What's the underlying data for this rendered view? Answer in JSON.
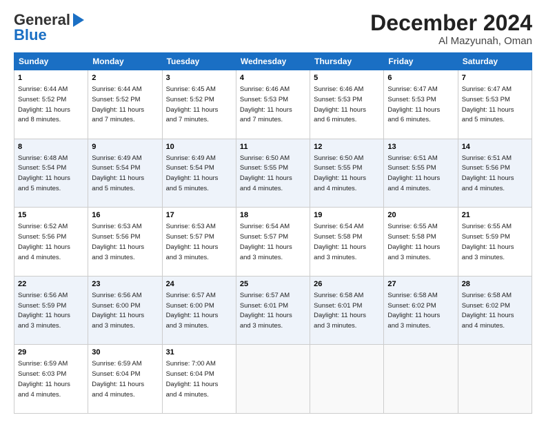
{
  "header": {
    "logo_line1": "General",
    "logo_line2": "Blue",
    "month_title": "December 2024",
    "location": "Al Mazyunah, Oman"
  },
  "days_of_week": [
    "Sunday",
    "Monday",
    "Tuesday",
    "Wednesday",
    "Thursday",
    "Friday",
    "Saturday"
  ],
  "weeks": [
    [
      {
        "day": "1",
        "info": "Sunrise: 6:44 AM\nSunset: 5:52 PM\nDaylight: 11 hours\nand 8 minutes."
      },
      {
        "day": "2",
        "info": "Sunrise: 6:44 AM\nSunset: 5:52 PM\nDaylight: 11 hours\nand 7 minutes."
      },
      {
        "day": "3",
        "info": "Sunrise: 6:45 AM\nSunset: 5:52 PM\nDaylight: 11 hours\nand 7 minutes."
      },
      {
        "day": "4",
        "info": "Sunrise: 6:46 AM\nSunset: 5:53 PM\nDaylight: 11 hours\nand 7 minutes."
      },
      {
        "day": "5",
        "info": "Sunrise: 6:46 AM\nSunset: 5:53 PM\nDaylight: 11 hours\nand 6 minutes."
      },
      {
        "day": "6",
        "info": "Sunrise: 6:47 AM\nSunset: 5:53 PM\nDaylight: 11 hours\nand 6 minutes."
      },
      {
        "day": "7",
        "info": "Sunrise: 6:47 AM\nSunset: 5:53 PM\nDaylight: 11 hours\nand 5 minutes."
      }
    ],
    [
      {
        "day": "8",
        "info": "Sunrise: 6:48 AM\nSunset: 5:54 PM\nDaylight: 11 hours\nand 5 minutes."
      },
      {
        "day": "9",
        "info": "Sunrise: 6:49 AM\nSunset: 5:54 PM\nDaylight: 11 hours\nand 5 minutes."
      },
      {
        "day": "10",
        "info": "Sunrise: 6:49 AM\nSunset: 5:54 PM\nDaylight: 11 hours\nand 5 minutes."
      },
      {
        "day": "11",
        "info": "Sunrise: 6:50 AM\nSunset: 5:55 PM\nDaylight: 11 hours\nand 4 minutes."
      },
      {
        "day": "12",
        "info": "Sunrise: 6:50 AM\nSunset: 5:55 PM\nDaylight: 11 hours\nand 4 minutes."
      },
      {
        "day": "13",
        "info": "Sunrise: 6:51 AM\nSunset: 5:55 PM\nDaylight: 11 hours\nand 4 minutes."
      },
      {
        "day": "14",
        "info": "Sunrise: 6:51 AM\nSunset: 5:56 PM\nDaylight: 11 hours\nand 4 minutes."
      }
    ],
    [
      {
        "day": "15",
        "info": "Sunrise: 6:52 AM\nSunset: 5:56 PM\nDaylight: 11 hours\nand 4 minutes."
      },
      {
        "day": "16",
        "info": "Sunrise: 6:53 AM\nSunset: 5:56 PM\nDaylight: 11 hours\nand 3 minutes."
      },
      {
        "day": "17",
        "info": "Sunrise: 6:53 AM\nSunset: 5:57 PM\nDaylight: 11 hours\nand 3 minutes."
      },
      {
        "day": "18",
        "info": "Sunrise: 6:54 AM\nSunset: 5:57 PM\nDaylight: 11 hours\nand 3 minutes."
      },
      {
        "day": "19",
        "info": "Sunrise: 6:54 AM\nSunset: 5:58 PM\nDaylight: 11 hours\nand 3 minutes."
      },
      {
        "day": "20",
        "info": "Sunrise: 6:55 AM\nSunset: 5:58 PM\nDaylight: 11 hours\nand 3 minutes."
      },
      {
        "day": "21",
        "info": "Sunrise: 6:55 AM\nSunset: 5:59 PM\nDaylight: 11 hours\nand 3 minutes."
      }
    ],
    [
      {
        "day": "22",
        "info": "Sunrise: 6:56 AM\nSunset: 5:59 PM\nDaylight: 11 hours\nand 3 minutes."
      },
      {
        "day": "23",
        "info": "Sunrise: 6:56 AM\nSunset: 6:00 PM\nDaylight: 11 hours\nand 3 minutes."
      },
      {
        "day": "24",
        "info": "Sunrise: 6:57 AM\nSunset: 6:00 PM\nDaylight: 11 hours\nand 3 minutes."
      },
      {
        "day": "25",
        "info": "Sunrise: 6:57 AM\nSunset: 6:01 PM\nDaylight: 11 hours\nand 3 minutes."
      },
      {
        "day": "26",
        "info": "Sunrise: 6:58 AM\nSunset: 6:01 PM\nDaylight: 11 hours\nand 3 minutes."
      },
      {
        "day": "27",
        "info": "Sunrise: 6:58 AM\nSunset: 6:02 PM\nDaylight: 11 hours\nand 3 minutes."
      },
      {
        "day": "28",
        "info": "Sunrise: 6:58 AM\nSunset: 6:02 PM\nDaylight: 11 hours\nand 4 minutes."
      }
    ],
    [
      {
        "day": "29",
        "info": "Sunrise: 6:59 AM\nSunset: 6:03 PM\nDaylight: 11 hours\nand 4 minutes."
      },
      {
        "day": "30",
        "info": "Sunrise: 6:59 AM\nSunset: 6:04 PM\nDaylight: 11 hours\nand 4 minutes."
      },
      {
        "day": "31",
        "info": "Sunrise: 7:00 AM\nSunset: 6:04 PM\nDaylight: 11 hours\nand 4 minutes."
      },
      {
        "day": "",
        "info": ""
      },
      {
        "day": "",
        "info": ""
      },
      {
        "day": "",
        "info": ""
      },
      {
        "day": "",
        "info": ""
      }
    ]
  ]
}
